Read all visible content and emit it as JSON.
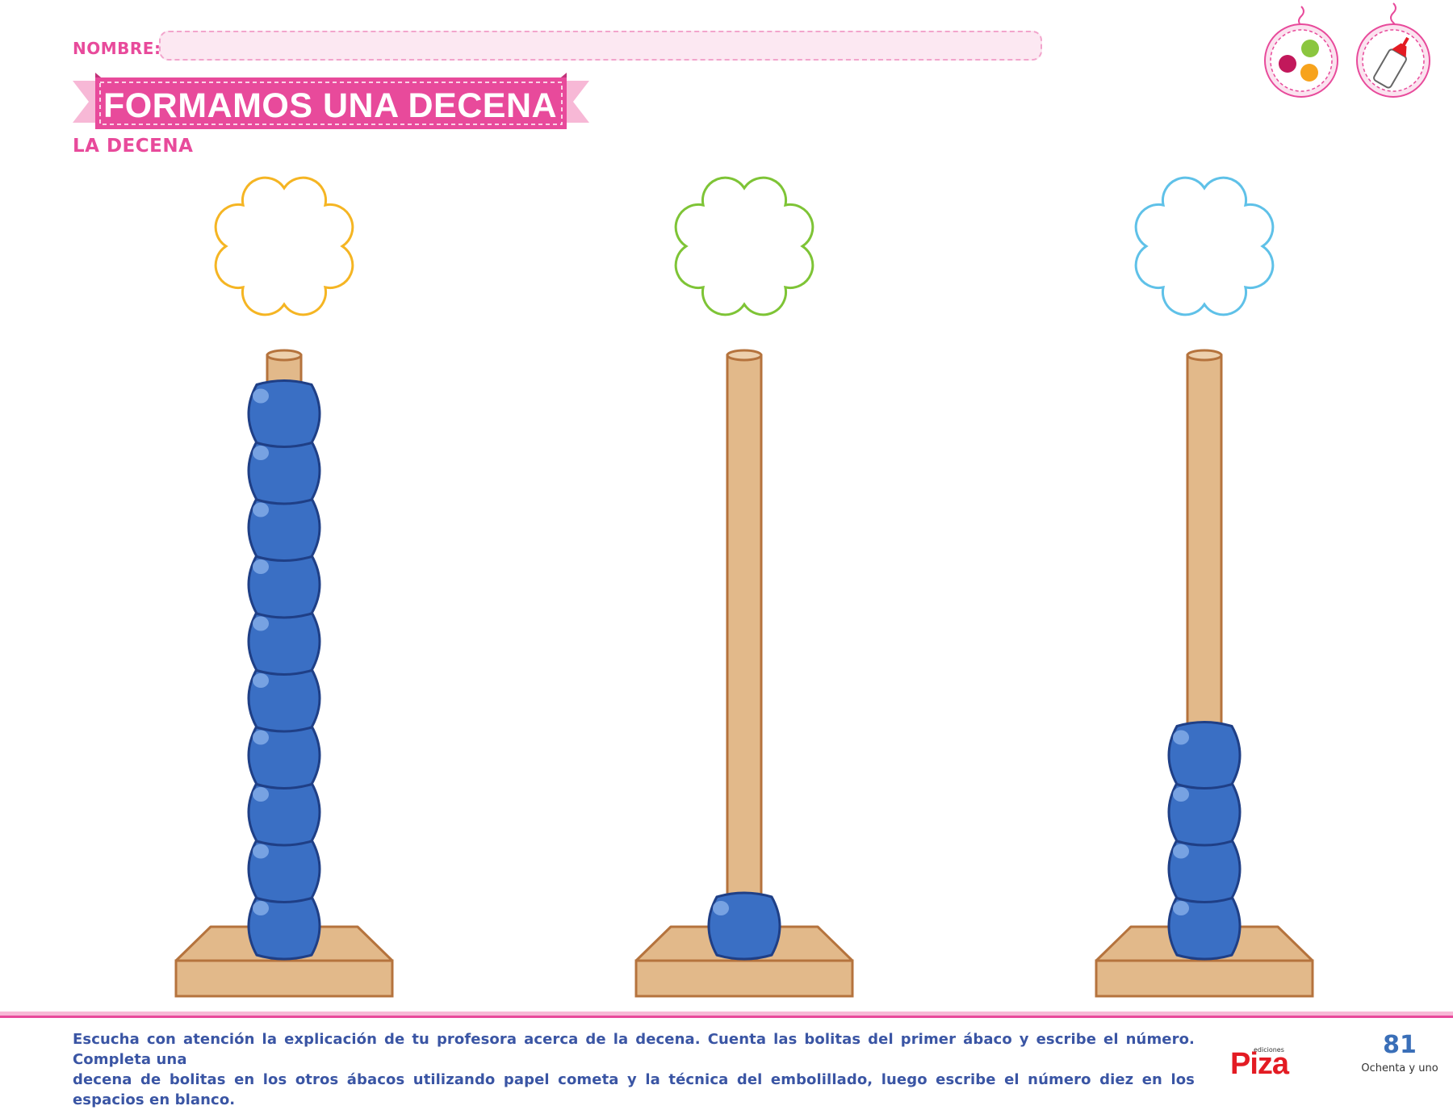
{
  "header": {
    "name_label": "NOMBRE:",
    "title": "FORMAMOS UNA DECENA",
    "subtitle": "LA DECENA"
  },
  "materials": [
    {
      "icon": "pompom-balls-icon"
    },
    {
      "icon": "glue-bottle-icon"
    }
  ],
  "abacuses": [
    {
      "flower_color": "#f5b523",
      "beads": 10
    },
    {
      "flower_color": "#7ec436",
      "beads": 1
    },
    {
      "flower_color": "#5fc1e8",
      "beads": 4
    }
  ],
  "colors": {
    "accent_pink": "#e84a9b",
    "bead_blue": "#3a6fc4",
    "wood": "#e2b98a",
    "wood_stroke": "#b5733d",
    "text_blue": "#3a55a4"
  },
  "footer": {
    "instruction_line1": "Escucha con atención la explicación de tu profesora acerca de la decena. Cuenta las bolitas del primer ábaco y escribe el número. Completa una",
    "instruction_line2": "decena de bolitas en los otros ábacos utilizando papel cometa y la técnica del embolillado, luego escribe el número diez en los espacios en blanco.",
    "brand_small": "ediciones",
    "brand": "Piza",
    "page_number": "81",
    "page_words": "Ochenta y uno"
  }
}
